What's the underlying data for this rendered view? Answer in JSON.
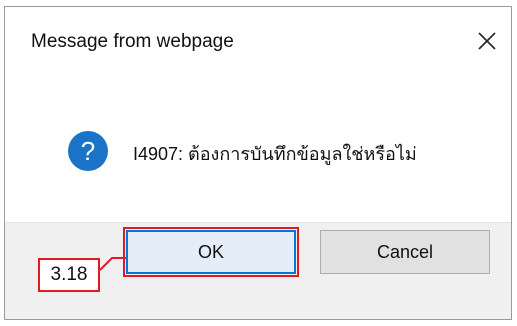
{
  "dialog": {
    "title": "Message from webpage",
    "close_icon": "close-icon",
    "message_icon": "question-icon",
    "message": "I4907: ต้องการบันทึกข้อมูลใช่หรือไม่",
    "ok_label": "OK",
    "cancel_label": "Cancel"
  },
  "annotation": {
    "step_label": "3.18"
  },
  "colors": {
    "question_icon": "#1a73c7",
    "highlight": "#e01b24",
    "focus": "#0078d7"
  }
}
